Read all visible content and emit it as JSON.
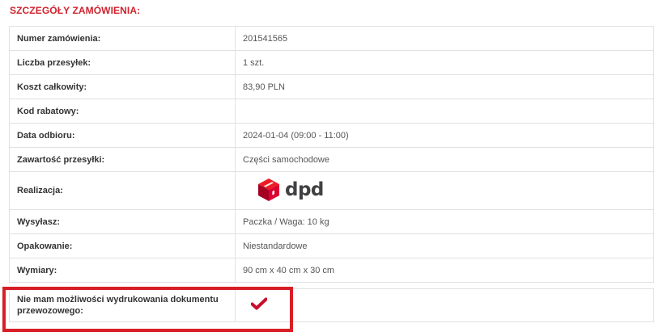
{
  "section": {
    "title": "SZCZEGÓŁY ZAMÓWIENIA:"
  },
  "details": {
    "rows": [
      {
        "label": "Numer zamówienia:",
        "value": "201541565"
      },
      {
        "label": "Liczba przesyłek:",
        "value": "1 szt."
      },
      {
        "label": "Koszt całkowity:",
        "value": "83,90 PLN"
      },
      {
        "label": "Kod rabatowy:",
        "value": ""
      },
      {
        "label": "Data odbioru:",
        "value": "2024-01-04 (09:00 - 11:00)"
      },
      {
        "label": "Zawartość przesyłki:",
        "value": "Części samochodowe"
      },
      {
        "label": "Realizacja:",
        "carrier_logo_icon": "dpd-logo-icon",
        "carrier_logo_text": "dpd"
      },
      {
        "label": "Wysyłasz:",
        "value": "Paczka / Waga: 10 kg"
      },
      {
        "label": "Opakowanie:",
        "value": "Niestandardowe"
      },
      {
        "label": "Wymiary:",
        "value": "90 cm x 40 cm x 30 cm"
      }
    ],
    "no_print_option": {
      "label": "Nie mam możliwości wydrukowania dokumentu przewozowego:",
      "icon": "checkmark-icon",
      "checked": true
    }
  },
  "colors": {
    "accent": "#d0232e",
    "highlight": "#d81e26",
    "dpd_red": "#dc0032",
    "dpd_grey": "#414042"
  }
}
